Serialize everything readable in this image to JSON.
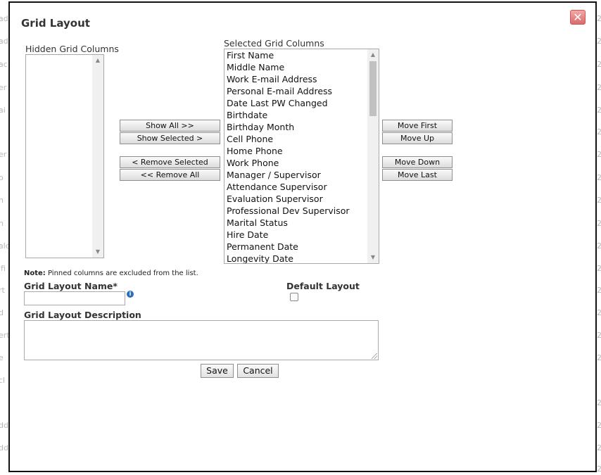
{
  "background": {
    "left_fragments": [
      "ad",
      "ad",
      "ac",
      "er",
      "ai",
      "er",
      "o",
      "n",
      "n",
      "alc",
      "ifi",
      "rt",
      "d",
      "ert",
      "e",
      "cl",
      "dd",
      "dd"
    ],
    "right_fragments": [
      "2",
      "2",
      "2",
      "2",
      "2",
      "2",
      "2",
      "2",
      "2",
      "2",
      "2",
      "2",
      "2",
      "2",
      "2",
      "2",
      "2",
      "2",
      "2",
      "2"
    ]
  },
  "dialog": {
    "title": "Grid Layout",
    "close_symbol": "✕",
    "close_icon": "close-icon"
  },
  "hidden": {
    "label": "Hidden Grid Columns",
    "items": []
  },
  "selected": {
    "label": "Selected Grid Columns",
    "items": [
      "First Name",
      "Middle Name",
      "Work E-mail Address",
      "Personal E-mail Address",
      "Date Last PW Changed",
      "Birthdate",
      "Birthday Month",
      "Cell Phone",
      "Home Phone",
      "Work Phone",
      "Manager / Supervisor",
      "Attendance Supervisor",
      "Evaluation Supervisor",
      "Professional Dev Supervisor",
      "Marital Status",
      "Hire Date",
      "Permanent Date",
      "Longevity Date"
    ]
  },
  "transfer_buttons": {
    "show_all": "Show All >>",
    "show_selected": "Show Selected >",
    "remove_selected": "< Remove Selected",
    "remove_all": "<< Remove All"
  },
  "order_buttons": {
    "move_first": "Move First",
    "move_up": "Move Up",
    "move_down": "Move Down",
    "move_last": "Move Last"
  },
  "note": {
    "bold": "Note:",
    "text": " Pinned columns are excluded from the list."
  },
  "form": {
    "name_label": "Grid Layout Name*",
    "name_value": "",
    "info_symbol": "i",
    "default_label": "Default Layout",
    "default_checked": false,
    "description_label": "Grid Layout Description",
    "description_value": ""
  },
  "actions": {
    "save": "Save",
    "cancel": "Cancel"
  },
  "colors": {
    "close_button": "#d96b6b",
    "info_icon": "#2a6ebb"
  }
}
